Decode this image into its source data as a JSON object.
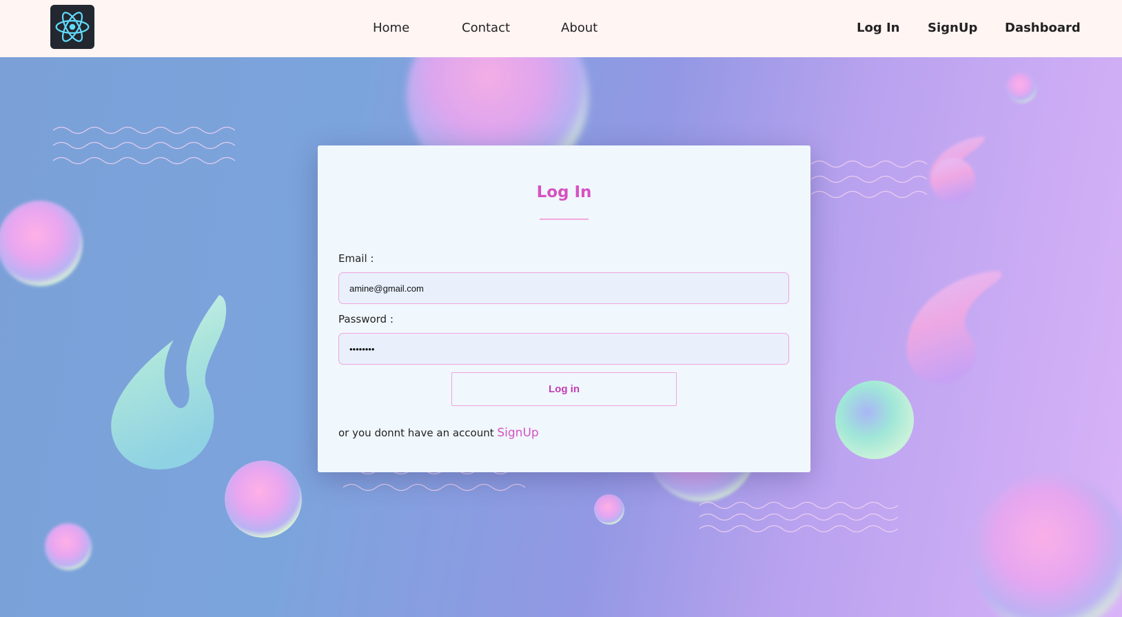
{
  "navbar": {
    "logo_icon": "react-atom-icon",
    "links": {
      "home": "Home",
      "contact": "Contact",
      "about": "About",
      "login": "Log In",
      "signup": "SignUp",
      "dashboard": "Dashboard"
    }
  },
  "login_form": {
    "title": "Log In",
    "email_label": "Email :",
    "email_value": "amine@gmail.com",
    "password_label": "Password :",
    "password_value": "********",
    "submit_label": "Log in",
    "footer_text": "or you donnt have an account ",
    "signup_link": "SignUp"
  },
  "colors": {
    "accent": "#d651c2",
    "navbar_bg": "#fff5f3",
    "card_bg": "#f0f7fd",
    "input_border": "#f1a3dd",
    "input_bg": "#e9f0fc",
    "logo_bg": "#23272f",
    "logo_atom": "#61dafb"
  }
}
